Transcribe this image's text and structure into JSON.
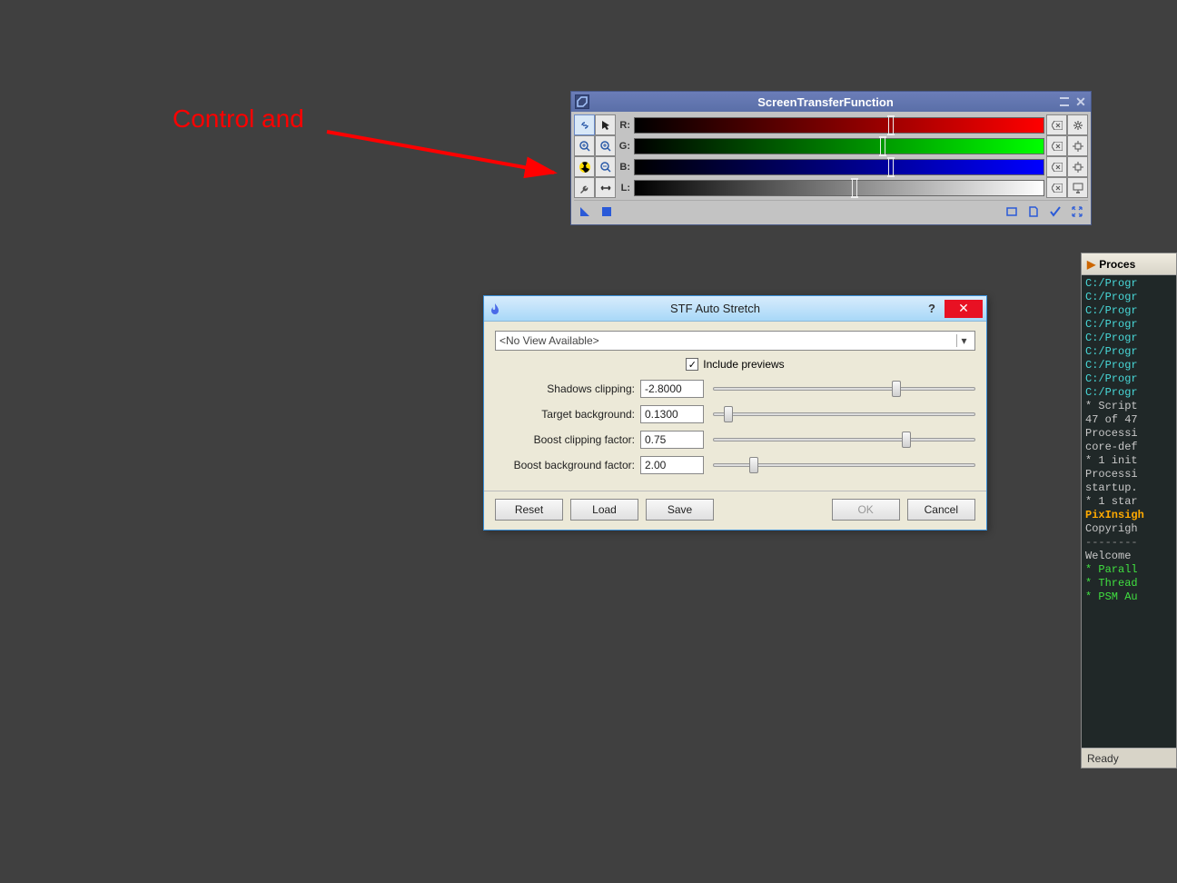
{
  "annotation": {
    "text": "Control and"
  },
  "stf": {
    "title": "ScreenTransferFunction",
    "channels": [
      {
        "label": "R:",
        "cls": "stf-grad-r",
        "handle": 62
      },
      {
        "label": "G:",
        "cls": "stf-grad-g",
        "handle": 60
      },
      {
        "label": "B:",
        "cls": "stf-grad-b",
        "handle": 62
      },
      {
        "label": "L:",
        "cls": "stf-grad-l",
        "handle": 53
      }
    ]
  },
  "dialog": {
    "title": "STF Auto Stretch",
    "combo": "<No View Available>",
    "include_previews": "Include previews",
    "params": [
      {
        "label": "Shadows clipping:",
        "value": "-2.8000",
        "thumb": 68
      },
      {
        "label": "Target background:",
        "value": "0.1300",
        "thumb": 4
      },
      {
        "label": "Boost clipping factor:",
        "value": "0.75",
        "thumb": 72
      },
      {
        "label": "Boost background factor:",
        "value": "2.00",
        "thumb": 14
      }
    ],
    "buttons": {
      "reset": "Reset",
      "load": "Load",
      "save": "Save",
      "ok": "OK",
      "cancel": "Cancel"
    }
  },
  "console": {
    "header": "Proces",
    "lines": [
      {
        "t": "C:/Progr",
        "c": "con-cyan"
      },
      {
        "t": "C:/Progr",
        "c": "con-cyan"
      },
      {
        "t": "C:/Progr",
        "c": "con-cyan"
      },
      {
        "t": "C:/Progr",
        "c": "con-cyan"
      },
      {
        "t": "C:/Progr",
        "c": "con-cyan"
      },
      {
        "t": "C:/Progr",
        "c": "con-cyan"
      },
      {
        "t": "C:/Progr",
        "c": "con-cyan"
      },
      {
        "t": "C:/Progr",
        "c": "con-cyan"
      },
      {
        "t": "C:/Progr",
        "c": "con-cyan"
      },
      {
        "t": "* Script",
        "c": ""
      },
      {
        "t": "47 of 47",
        "c": ""
      },
      {
        "t": "",
        "c": ""
      },
      {
        "t": "Processi",
        "c": ""
      },
      {
        "t": "core-def",
        "c": ""
      },
      {
        "t": "",
        "c": ""
      },
      {
        "t": "* 1 init",
        "c": ""
      },
      {
        "t": "",
        "c": ""
      },
      {
        "t": "Processi",
        "c": ""
      },
      {
        "t": "startup.",
        "c": ""
      },
      {
        "t": "* 1 star",
        "c": ""
      },
      {
        "t": "",
        "c": ""
      },
      {
        "t": "PixInsigh",
        "c": "con-orange"
      },
      {
        "t": "Copyrigh",
        "c": ""
      },
      {
        "t": "--------",
        "c": "con-gray"
      },
      {
        "t": "Welcome ",
        "c": ""
      },
      {
        "t": "",
        "c": ""
      },
      {
        "t": "* Parall",
        "c": "con-green"
      },
      {
        "t": "* Thread",
        "c": "con-green"
      },
      {
        "t": "* PSM Au",
        "c": "con-green"
      }
    ],
    "status": "Ready"
  }
}
